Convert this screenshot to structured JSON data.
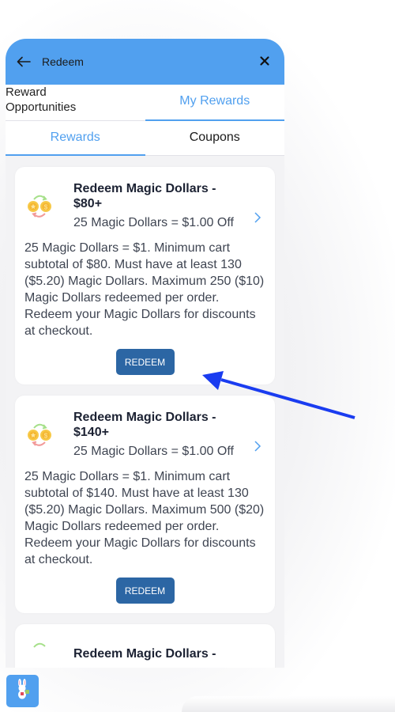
{
  "header": {
    "title": "Redeem",
    "back_icon": "arrow-left-icon",
    "close_icon": "close-icon"
  },
  "top_tabs": [
    {
      "label": "Reward Opportunities",
      "active": false
    },
    {
      "label": "My Rewards",
      "active": true
    }
  ],
  "sub_tabs": [
    {
      "label": "Rewards",
      "active": true
    },
    {
      "label": "Coupons",
      "active": false
    }
  ],
  "rewards": [
    {
      "title": "Redeem Magic Dollars - $80+",
      "subtitle": "25 Magic Dollars = $1.00 Off",
      "description": "25 Magic Dollars = $1. Minimum cart subtotal of $80. Must have at least 130 ($5.20) Magic Dollars. Maximum 250 ($10) Magic Dollars redeemed per order. Redeem your Magic Dollars for discounts at checkout.",
      "button_label": "REDEEM"
    },
    {
      "title": "Redeem Magic Dollars - $140+",
      "subtitle": "25 Magic Dollars = $1.00 Off",
      "description": "25 Magic Dollars = $1. Minimum cart subtotal of $140. Must have at least 130 ($5.20) Magic Dollars. Maximum 500 ($20) Magic Dollars redeemed per order. Redeem your Magic Dollars for discounts at checkout.",
      "button_label": "REDEEM"
    },
    {
      "title": "Redeem Magic Dollars -"
    }
  ],
  "launcher": {
    "icon": "bunny-mascot-icon"
  },
  "colors": {
    "accent": "#51a0ef",
    "button": "#2c66a4",
    "annotation_arrow": "#1a3cf0"
  }
}
